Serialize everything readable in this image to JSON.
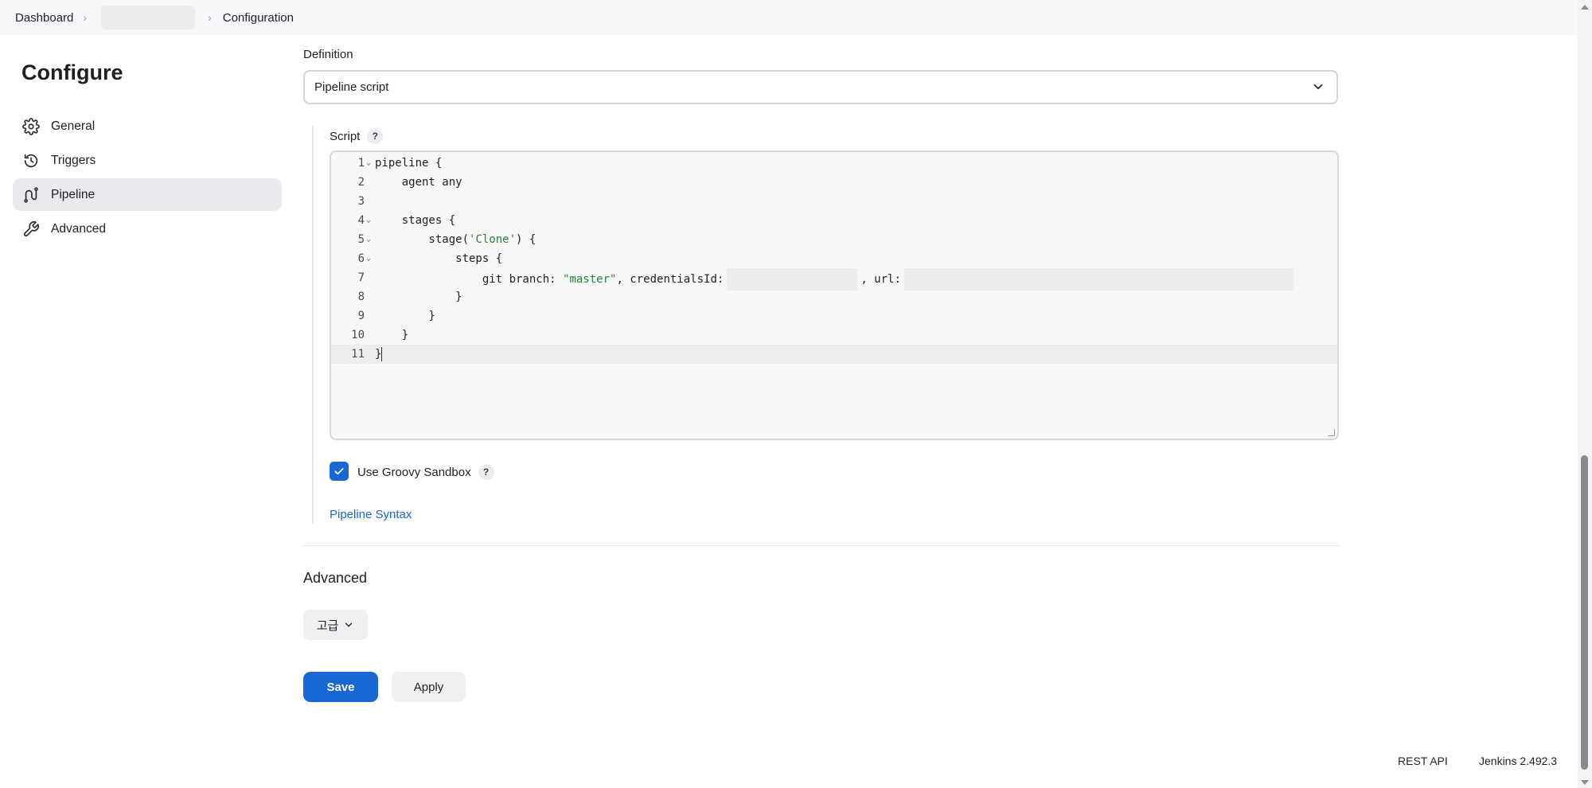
{
  "breadcrumb": {
    "items": [
      "Dashboard",
      "",
      "Configuration"
    ]
  },
  "sidebar": {
    "title": "Configure",
    "items": [
      {
        "label": "General",
        "icon": "gear-icon",
        "active": false
      },
      {
        "label": "Triggers",
        "icon": "clock-icon",
        "active": false
      },
      {
        "label": "Pipeline",
        "icon": "pipeline-icon",
        "active": true
      },
      {
        "label": "Advanced",
        "icon": "wrench-icon",
        "active": false
      }
    ]
  },
  "definition": {
    "label": "Definition",
    "selected": "Pipeline script"
  },
  "script": {
    "label": "Script",
    "help": "?",
    "lines": [
      {
        "num": "1",
        "fold": true,
        "text": "pipeline {"
      },
      {
        "num": "2",
        "fold": false,
        "text": "    agent any"
      },
      {
        "num": "3",
        "fold": false,
        "text": ""
      },
      {
        "num": "4",
        "fold": true,
        "text": "    stages {"
      },
      {
        "num": "5",
        "fold": true,
        "pre": "        stage(",
        "str": "'Clone'",
        "post": ") {"
      },
      {
        "num": "6",
        "fold": true,
        "text": "            steps {"
      },
      {
        "num": "7",
        "fold": false,
        "pre": "                git branch: ",
        "str": "\"master\"",
        "mid": ", credentialsId:",
        "mid2": ", url:"
      },
      {
        "num": "8",
        "fold": false,
        "text": "            }"
      },
      {
        "num": "9",
        "fold": false,
        "text": "        }"
      },
      {
        "num": "10",
        "fold": false,
        "text": "    }"
      },
      {
        "num": "11",
        "fold": false,
        "text": "}"
      }
    ]
  },
  "sandbox": {
    "label": "Use Groovy Sandbox",
    "checked": true,
    "help": "?"
  },
  "pipeline_syntax": "Pipeline Syntax",
  "advanced": {
    "title": "Advanced",
    "button": "고급"
  },
  "actions": {
    "save": "Save",
    "apply": "Apply"
  },
  "footer": {
    "rest_api": "REST API",
    "version": "Jenkins 2.492.3"
  },
  "colors": {
    "accent": "#1967d2",
    "string": "#22863a"
  }
}
